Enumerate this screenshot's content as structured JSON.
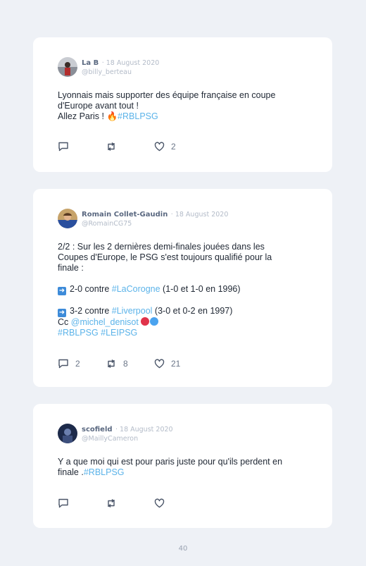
{
  "tweets": [
    {
      "name": "La B",
      "date": "· 18 August 2020",
      "handle": "@billy_berteau",
      "lines": [
        "Lyonnais mais supporter des équipe française en coupe",
        "d'Europe avant tout !"
      ],
      "line3_prefix": "Allez Paris ! ",
      "line3_emoji": "🔥",
      "line3_tag": "#RBLPSG",
      "replies": "",
      "retweets": "",
      "likes": "2"
    },
    {
      "name": "Romain Collet-Gaudin",
      "date": "· 18 August 2020",
      "handle": "@RomainCG75",
      "lines": [
        "2/2 : Sur les 2 dernières demi-finales jouées dans les",
        "Coupes d'Europe, le PSG s'est toujours qualifié pour la",
        "finale :"
      ],
      "item1": {
        "emoji": "➡️",
        "pre": "2-0 contre ",
        "tag": "#LaCorogne",
        "post": " (1-0 et 1-0 en 1996)"
      },
      "item2": {
        "emoji": "➡️",
        "pre": "3-2 contre ",
        "tag": "#Liverpool",
        "post": " (3-0 et 0-2 en 1997)"
      },
      "cc_prefix": "Cc ",
      "cc_mention": "@michel_denisot",
      "cc_emojis": "🔴🔵",
      "tags_line": "#RBLPSG #LEIPSG",
      "replies": "2",
      "retweets": "8",
      "likes": "21"
    },
    {
      "name": "scofield",
      "date": "· 18 August 2020",
      "handle": "@MaillyCameron",
      "lines": [
        "Y a que moi qui est pour paris juste pour qu'ils perdent en"
      ],
      "line2_prefix": "finale .",
      "line2_tag": "#RBLPSG",
      "replies": "",
      "retweets": "",
      "likes": ""
    }
  ],
  "page_number": "40",
  "colors": {
    "link": "#5bb3e9",
    "text": "#222a36",
    "muted": "#b3bbc8",
    "background": "#eef1f6"
  },
  "icons": [
    "reply-icon",
    "retweet-icon",
    "like-icon"
  ]
}
